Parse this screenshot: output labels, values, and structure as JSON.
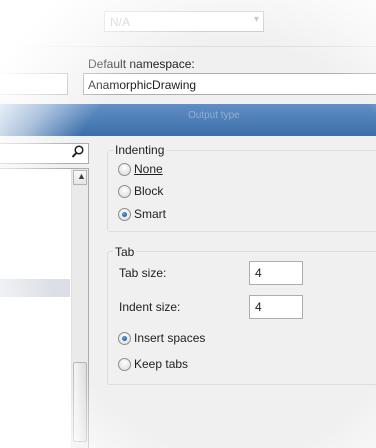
{
  "top": {
    "dropdown_value": "N/A"
  },
  "namespace": {
    "label": "Default namespace:",
    "value": "AnamorphicDrawing"
  },
  "header_bar": {
    "faint_text": "Output type"
  },
  "search": {
    "placeholder": "",
    "icon": "search-icon"
  },
  "indenting": {
    "title": "Indenting",
    "options": [
      {
        "label": "None",
        "selected": false
      },
      {
        "label": "Block",
        "selected": false
      },
      {
        "label": "Smart",
        "selected": true
      }
    ]
  },
  "tab": {
    "title": "Tab",
    "tab_size_label": "Tab size:",
    "tab_size_value": "4",
    "indent_size_label": "Indent size:",
    "indent_size_value": "4",
    "options": [
      {
        "label": "Insert spaces",
        "selected": true
      },
      {
        "label": "Keep tabs",
        "selected": false
      }
    ]
  },
  "colors": {
    "accent": "#1f5fb0",
    "panel_bg": "#f0f0f0",
    "list_selection": "#dcdfe6"
  }
}
